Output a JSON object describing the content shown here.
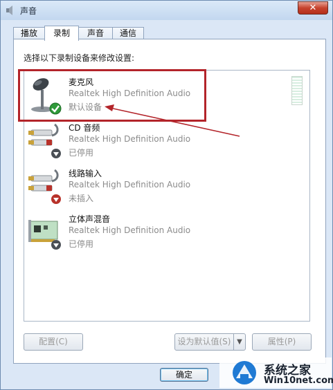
{
  "window": {
    "title": "声音",
    "close_glyph": "✕"
  },
  "tabs": [
    {
      "label": "播放"
    },
    {
      "label": "录制"
    },
    {
      "label": "声音"
    },
    {
      "label": "通信"
    }
  ],
  "pane": {
    "instruction": "选择以下录制设备来修改设置:"
  },
  "devices": [
    {
      "name": "麦克风",
      "driver": "Realtek High Definition Audio",
      "status": "默认设备",
      "icon": "microphone-icon",
      "badge": "default-check-icon"
    },
    {
      "name": "CD 音频",
      "driver": "Realtek High Definition Audio",
      "status": "已停用",
      "icon": "rca-cable-icon",
      "badge": "disabled-down-icon"
    },
    {
      "name": "线路输入",
      "driver": "Realtek High Definition Audio",
      "status": "未插入",
      "icon": "rca-cable-icon",
      "badge": "unplugged-down-icon"
    },
    {
      "name": "立体声混音",
      "driver": "Realtek High Definition Audio",
      "status": "已停用",
      "icon": "sound-card-icon",
      "badge": "disabled-down-icon"
    }
  ],
  "buttons": {
    "configure": "配置(C)",
    "set_default": "设为默认值(S)",
    "properties": "属性(P)",
    "ok": "确定"
  },
  "watermark": {
    "title": "系统之家",
    "site": "Win10net.com"
  },
  "colors": {
    "highlight": "#b3242a",
    "check": "#2f9a3a"
  }
}
